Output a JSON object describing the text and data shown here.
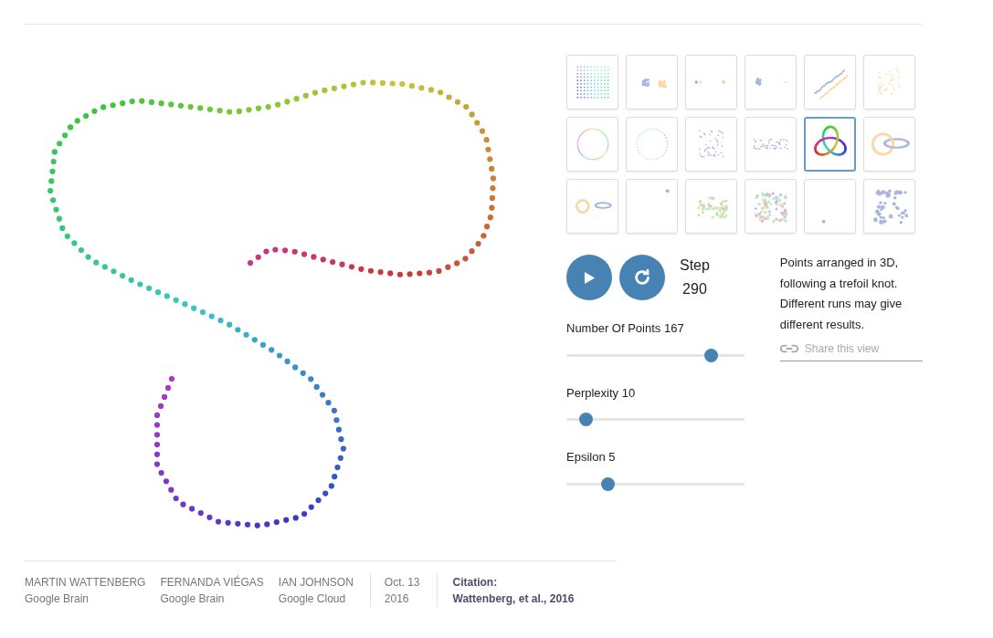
{
  "examples": [
    {
      "kind": "grid",
      "selected": false
    },
    {
      "kind": "two-clusters",
      "selected": false
    },
    {
      "kind": "three-dots",
      "selected": false
    },
    {
      "kind": "far-clusters",
      "selected": false
    },
    {
      "kind": "parallel-lines",
      "selected": false
    },
    {
      "kind": "scatter-warm",
      "selected": false
    },
    {
      "kind": "circle",
      "selected": false
    },
    {
      "kind": "sparse-circle",
      "selected": false
    },
    {
      "kind": "scatter",
      "selected": false
    },
    {
      "kind": "elongated",
      "selected": false
    },
    {
      "kind": "knot",
      "selected": true
    },
    {
      "kind": "linked-rings",
      "selected": false
    },
    {
      "kind": "separate-rings",
      "selected": false
    },
    {
      "kind": "corner-dot",
      "selected": false
    },
    {
      "kind": "mixed-cloud",
      "selected": false
    },
    {
      "kind": "dense-cloud",
      "selected": false
    },
    {
      "kind": "single-dot",
      "selected": false
    },
    {
      "kind": "big-scatter",
      "selected": false
    }
  ],
  "controls": {
    "play_button": {
      "playing": false
    },
    "step_label": "Step",
    "step_value": "290"
  },
  "sliders": [
    {
      "label": "Number Of Points 167",
      "level": 0.81
    },
    {
      "label": "Perplexity 10",
      "level": 0.11
    },
    {
      "label": "Epsilon 5",
      "level": 0.23
    }
  ],
  "description": "Points arranged in 3D, following a trefoil knot. Different runs may give different results.",
  "share_link": "Share this view",
  "footer": {
    "authors": [
      {
        "name": "MARTIN WATTENBERG",
        "affiliation": "Google Brain"
      },
      {
        "name": "FERNANDA VIÉGAS",
        "affiliation": "Google Brain"
      },
      {
        "name": "IAN JOHNSON",
        "affiliation": "Google Cloud"
      }
    ],
    "date": [
      "Oct. 13",
      "2016"
    ],
    "citation": {
      "label": "Citation:",
      "text": "Wattenberg, et al., 2016"
    }
  }
}
